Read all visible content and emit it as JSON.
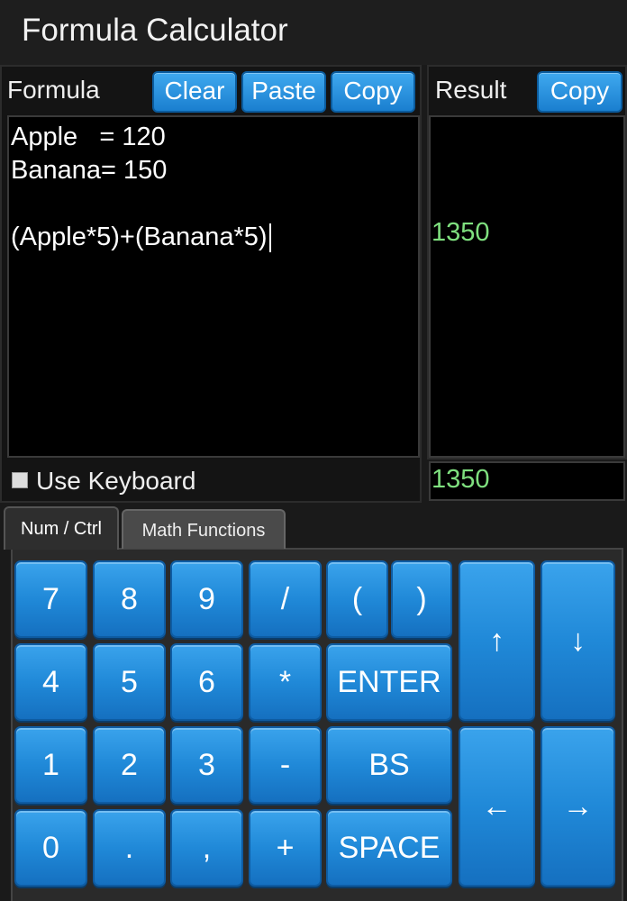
{
  "app": {
    "title": "Formula Calculator"
  },
  "formula_panel": {
    "label": "Formula",
    "clear_label": "Clear",
    "paste_label": "Paste",
    "copy_label": "Copy",
    "lines": [
      "Apple   = 120",
      "Banana= 150",
      "",
      "(Apple*5)+(Banana*5)"
    ]
  },
  "result_panel": {
    "label": "Result",
    "copy_label": "Copy",
    "line_result": "1350",
    "total": "1350"
  },
  "keyboard_toggle": {
    "label": "Use Keyboard",
    "checked": false
  },
  "tabs": [
    {
      "label": "Num / Ctrl",
      "active": true
    },
    {
      "label": "Math Functions",
      "active": false
    }
  ],
  "keys": {
    "k7": "7",
    "k8": "8",
    "k9": "9",
    "div": "/",
    "lparen": "(",
    "rparen": ")",
    "k4": "4",
    "k5": "5",
    "k6": "6",
    "mul": "*",
    "enter": "ENTER",
    "k1": "1",
    "k2": "2",
    "k3": "3",
    "sub": "-",
    "bs": "BS",
    "k0": "0",
    "dot": ".",
    "comma": ",",
    "add": "+",
    "space": "SPACE",
    "up": "↑",
    "down": "↓",
    "left": "←",
    "right": "→"
  }
}
